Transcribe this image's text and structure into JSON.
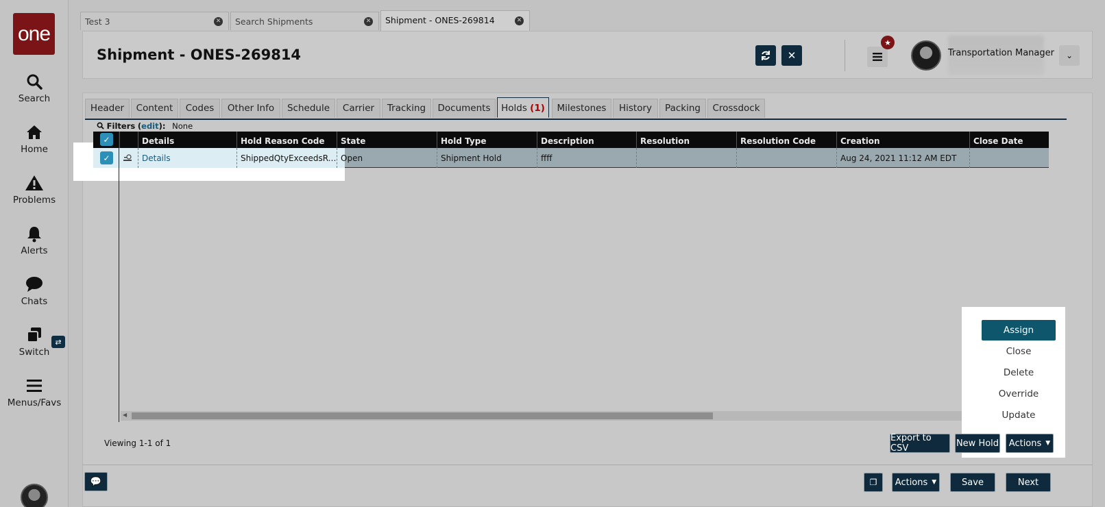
{
  "sidebar": {
    "logo": "one",
    "items": [
      {
        "label": "Search",
        "icon": "search-icon"
      },
      {
        "label": "Home",
        "icon": "home-icon"
      },
      {
        "label": "Problems",
        "icon": "warning-icon"
      },
      {
        "label": "Alerts",
        "icon": "bell-icon"
      },
      {
        "label": "Chats",
        "icon": "chat-icon"
      },
      {
        "label": "Switch",
        "icon": "switch-icon"
      },
      {
        "label": "Menus/Favs",
        "icon": "hamburger-icon"
      }
    ]
  },
  "doc_tabs": [
    {
      "label": "Test 3"
    },
    {
      "label": "Search Shipments"
    },
    {
      "label": "Shipment - ONES-269814"
    }
  ],
  "header": {
    "title": "Shipment - ONES-269814",
    "user_role": "Transportation Manager"
  },
  "tabs": [
    {
      "label": "Header"
    },
    {
      "label": "Content"
    },
    {
      "label": "Codes"
    },
    {
      "label": "Other Info"
    },
    {
      "label": "Schedule"
    },
    {
      "label": "Carrier"
    },
    {
      "label": "Tracking"
    },
    {
      "label": "Documents"
    },
    {
      "label": "Holds",
      "count": "(1)"
    },
    {
      "label": "Milestones"
    },
    {
      "label": "History"
    },
    {
      "label": "Packing"
    },
    {
      "label": "Crossdock"
    }
  ],
  "filters": {
    "label": "Filters",
    "edit": "edit",
    "value": "None"
  },
  "grid": {
    "columns": [
      "Details",
      "Hold Reason Code",
      "State",
      "Hold Type",
      "Description",
      "Resolution",
      "Resolution Code",
      "Creation",
      "Close Date"
    ],
    "rows": [
      {
        "details": "Details",
        "hold_reason_code": "ShippedQtyExceedsRequ...",
        "state": "Open",
        "hold_type": "Shipment Hold",
        "description": "ffff",
        "resolution": "",
        "resolution_code": "",
        "creation": "Aug 24, 2021 11:12 AM EDT",
        "close_date": ""
      }
    ]
  },
  "viewing": "Viewing 1-1 of 1",
  "grid_buttons": {
    "export": "Export to CSV",
    "new_hold": "New Hold",
    "actions": "Actions"
  },
  "actions_menu": [
    "Assign",
    "Close",
    "Delete",
    "Override",
    "Update"
  ],
  "footer": {
    "actions": "Actions",
    "save": "Save",
    "next": "Next"
  },
  "colors": {
    "brand": "#7a1416",
    "primary": "#0e2a3c",
    "accent": "#0e566c"
  }
}
